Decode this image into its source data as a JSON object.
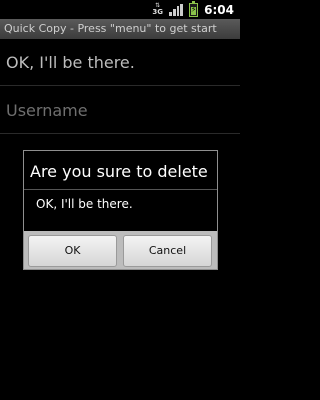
{
  "status_bar": {
    "network_label": "3G",
    "time": "6:04",
    "battery_level": 0.7,
    "battery_color": "#8bc34a"
  },
  "app": {
    "title": "Quick Copy - Press \"menu\" to get start"
  },
  "list": {
    "items": [
      {
        "text": "OK, I'll be there."
      },
      {
        "text": "Username"
      }
    ]
  },
  "dialog": {
    "title": "Are you sure to delete",
    "message": "OK, I'll be there.",
    "ok_label": "OK",
    "cancel_label": "Cancel"
  }
}
